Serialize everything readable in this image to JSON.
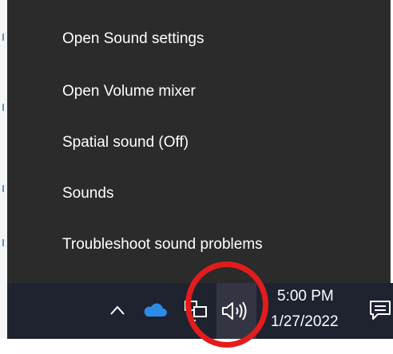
{
  "menu": {
    "items": [
      {
        "label": "Open Sound settings"
      },
      {
        "label": "Open Volume mixer"
      },
      {
        "label": "Spatial sound (Off)"
      },
      {
        "label": "Sounds"
      },
      {
        "label": "Troubleshoot sound problems"
      }
    ]
  },
  "taskbar": {
    "tray_icons": [
      "chevron-up-icon",
      "onedrive-cloud-icon",
      "network-icon",
      "speaker-volume-icon",
      "action-center-icon"
    ],
    "time": "5:00 PM",
    "date": "1/27/2022"
  },
  "colors": {
    "menu_background": "#2b2b2b",
    "taskbar_background": "#1f2330",
    "annotation": "#e21c1c",
    "onedrive": "#2b8ce8"
  }
}
